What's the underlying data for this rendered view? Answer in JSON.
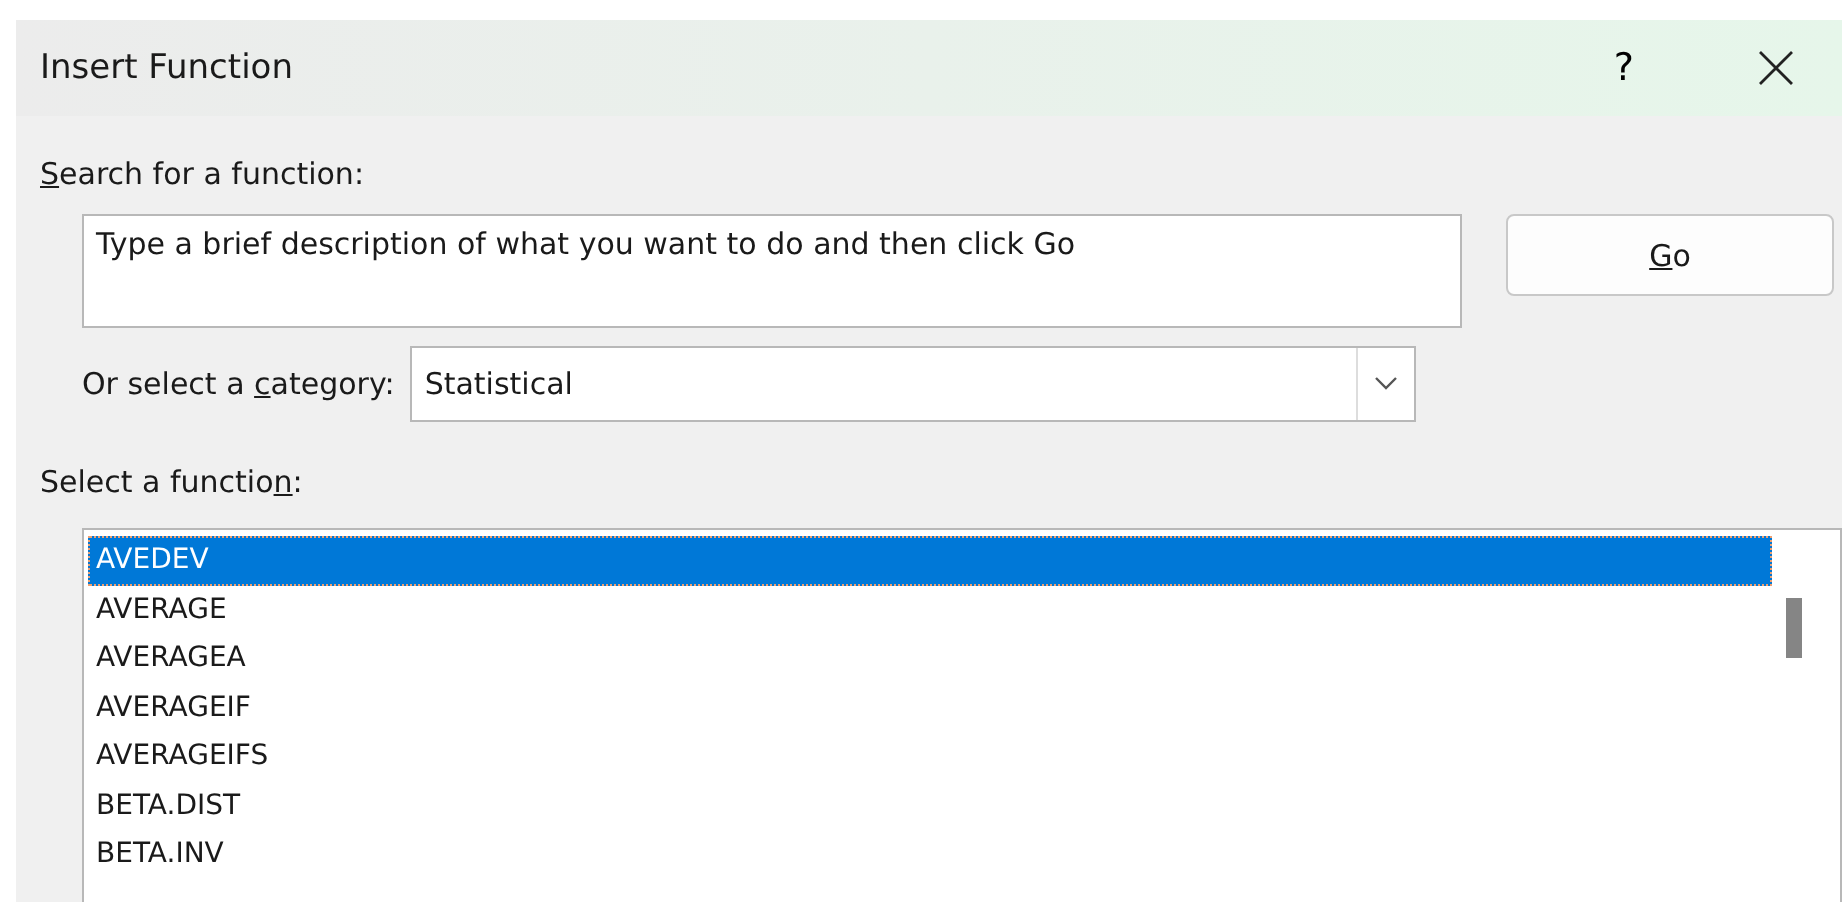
{
  "window": {
    "title": "Insert Function",
    "help": "?"
  },
  "search": {
    "label": {
      "key": "S",
      "after": "earch for a function:"
    },
    "placeholder": "Type a brief description of what you want to do and then click Go"
  },
  "go_button": {
    "key": "G",
    "after": "o"
  },
  "category": {
    "label": {
      "before": "Or select a ",
      "key": "c",
      "after": "ategory:"
    },
    "value": "Statistical"
  },
  "functions": {
    "label": {
      "before": "Select a functio",
      "key": "n",
      "after": ":"
    },
    "items": [
      {
        "name": "AVEDEV",
        "selected": true
      },
      {
        "name": "AVERAGE",
        "selected": false
      },
      {
        "name": "AVERAGEA",
        "selected": false
      },
      {
        "name": "AVERAGEIF",
        "selected": false
      },
      {
        "name": "AVERAGEIFS",
        "selected": false
      },
      {
        "name": "BETA.DIST",
        "selected": false
      },
      {
        "name": "BETA.INV",
        "selected": false
      }
    ]
  }
}
